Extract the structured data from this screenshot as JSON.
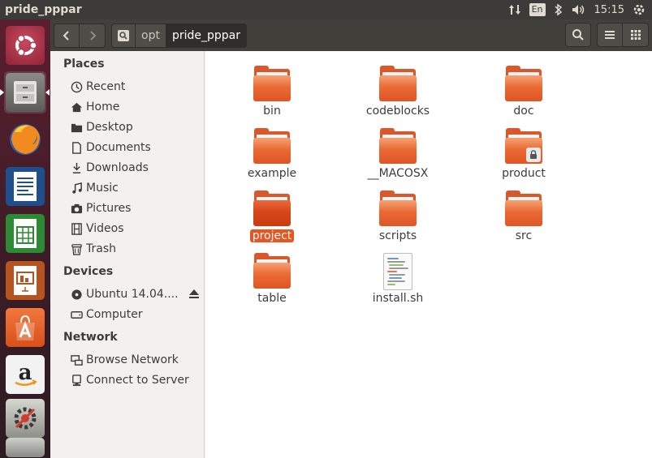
{
  "window": {
    "title": "pride_pppar"
  },
  "top_panel": {
    "keyboard_layout": "En",
    "time": "15:15",
    "indicators": [
      "network-updown-icon",
      "keyboard-layout-icon",
      "bluetooth-icon",
      "volume-icon"
    ]
  },
  "launcher": {
    "items": [
      {
        "name": "dash-home",
        "icon": "ubuntu-logo-icon"
      },
      {
        "name": "files",
        "icon": "file-cabinet-icon"
      },
      {
        "name": "firefox",
        "icon": "firefox-icon"
      },
      {
        "name": "libreoffice-writer",
        "icon": "writer-icon"
      },
      {
        "name": "libreoffice-calc",
        "icon": "calc-icon"
      },
      {
        "name": "libreoffice-impress",
        "icon": "impress-icon"
      },
      {
        "name": "ubuntu-software-center",
        "icon": "software-center-icon"
      },
      {
        "name": "amazon",
        "icon": "amazon-icon"
      },
      {
        "name": "system-settings",
        "icon": "settings-icon"
      }
    ]
  },
  "breadcrumb": {
    "root_icon": "location-toggle-icon",
    "items": [
      "opt",
      "pride_pppar"
    ]
  },
  "sidebar": {
    "places_title": "Places",
    "places": [
      {
        "label": "Recent",
        "icon": "clock-icon"
      },
      {
        "label": "Home",
        "icon": "home-icon"
      },
      {
        "label": "Desktop",
        "icon": "desktop-folder-icon"
      },
      {
        "label": "Documents",
        "icon": "document-icon"
      },
      {
        "label": "Downloads",
        "icon": "download-icon"
      },
      {
        "label": "Music",
        "icon": "music-icon"
      },
      {
        "label": "Pictures",
        "icon": "camera-icon"
      },
      {
        "label": "Videos",
        "icon": "film-icon"
      },
      {
        "label": "Trash",
        "icon": "trash-icon"
      }
    ],
    "devices_title": "Devices",
    "devices": [
      {
        "label": "Ubuntu 14.04....",
        "icon": "disc-icon"
      },
      {
        "label": "Computer",
        "icon": "drive-icon"
      }
    ],
    "network_title": "Network",
    "network": [
      {
        "label": "Browse Network",
        "icon": "network-icon"
      },
      {
        "label": "Connect to Server",
        "icon": "server-icon"
      }
    ]
  },
  "files": [
    {
      "name": "bin",
      "type": "folder"
    },
    {
      "name": "codeblocks",
      "type": "folder"
    },
    {
      "name": "doc",
      "type": "folder"
    },
    {
      "name": "example",
      "type": "folder"
    },
    {
      "name": "__MACOSX",
      "type": "folder"
    },
    {
      "name": "product",
      "type": "folder-locked"
    },
    {
      "name": "project",
      "type": "folder",
      "selected": true
    },
    {
      "name": "scripts",
      "type": "folder"
    },
    {
      "name": "src",
      "type": "folder"
    },
    {
      "name": "table",
      "type": "folder"
    },
    {
      "name": "install.sh",
      "type": "shell-script"
    }
  ],
  "colors": {
    "accent": "#e95420",
    "headerbar": "#41403b",
    "panel": "#3c3b37"
  }
}
